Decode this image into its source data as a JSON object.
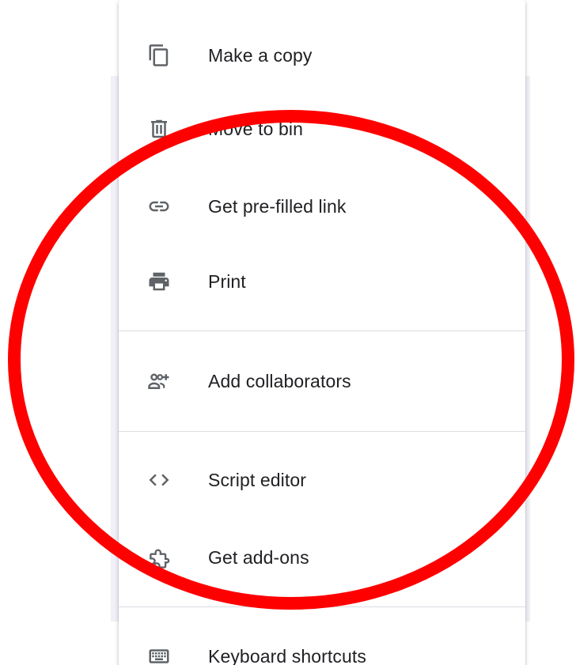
{
  "menu": {
    "items": [
      {
        "label": "Make a copy",
        "icon": "copy-icon"
      },
      {
        "label": "Move to bin",
        "icon": "trash-icon"
      },
      {
        "label": "Get pre-filled link",
        "icon": "link-icon"
      },
      {
        "label": "Print",
        "icon": "printer-icon"
      },
      {
        "label": "Add collaborators",
        "icon": "add-people-icon"
      },
      {
        "label": "Script editor",
        "icon": "code-icon"
      },
      {
        "label": "Get add-ons",
        "icon": "puzzle-icon"
      },
      {
        "label": "Keyboard shortcuts",
        "icon": "keyboard-icon"
      }
    ]
  },
  "colors": {
    "icon": "#5f6368",
    "text": "#202124",
    "divider": "#dadce0",
    "annotation": "#ff0000"
  }
}
